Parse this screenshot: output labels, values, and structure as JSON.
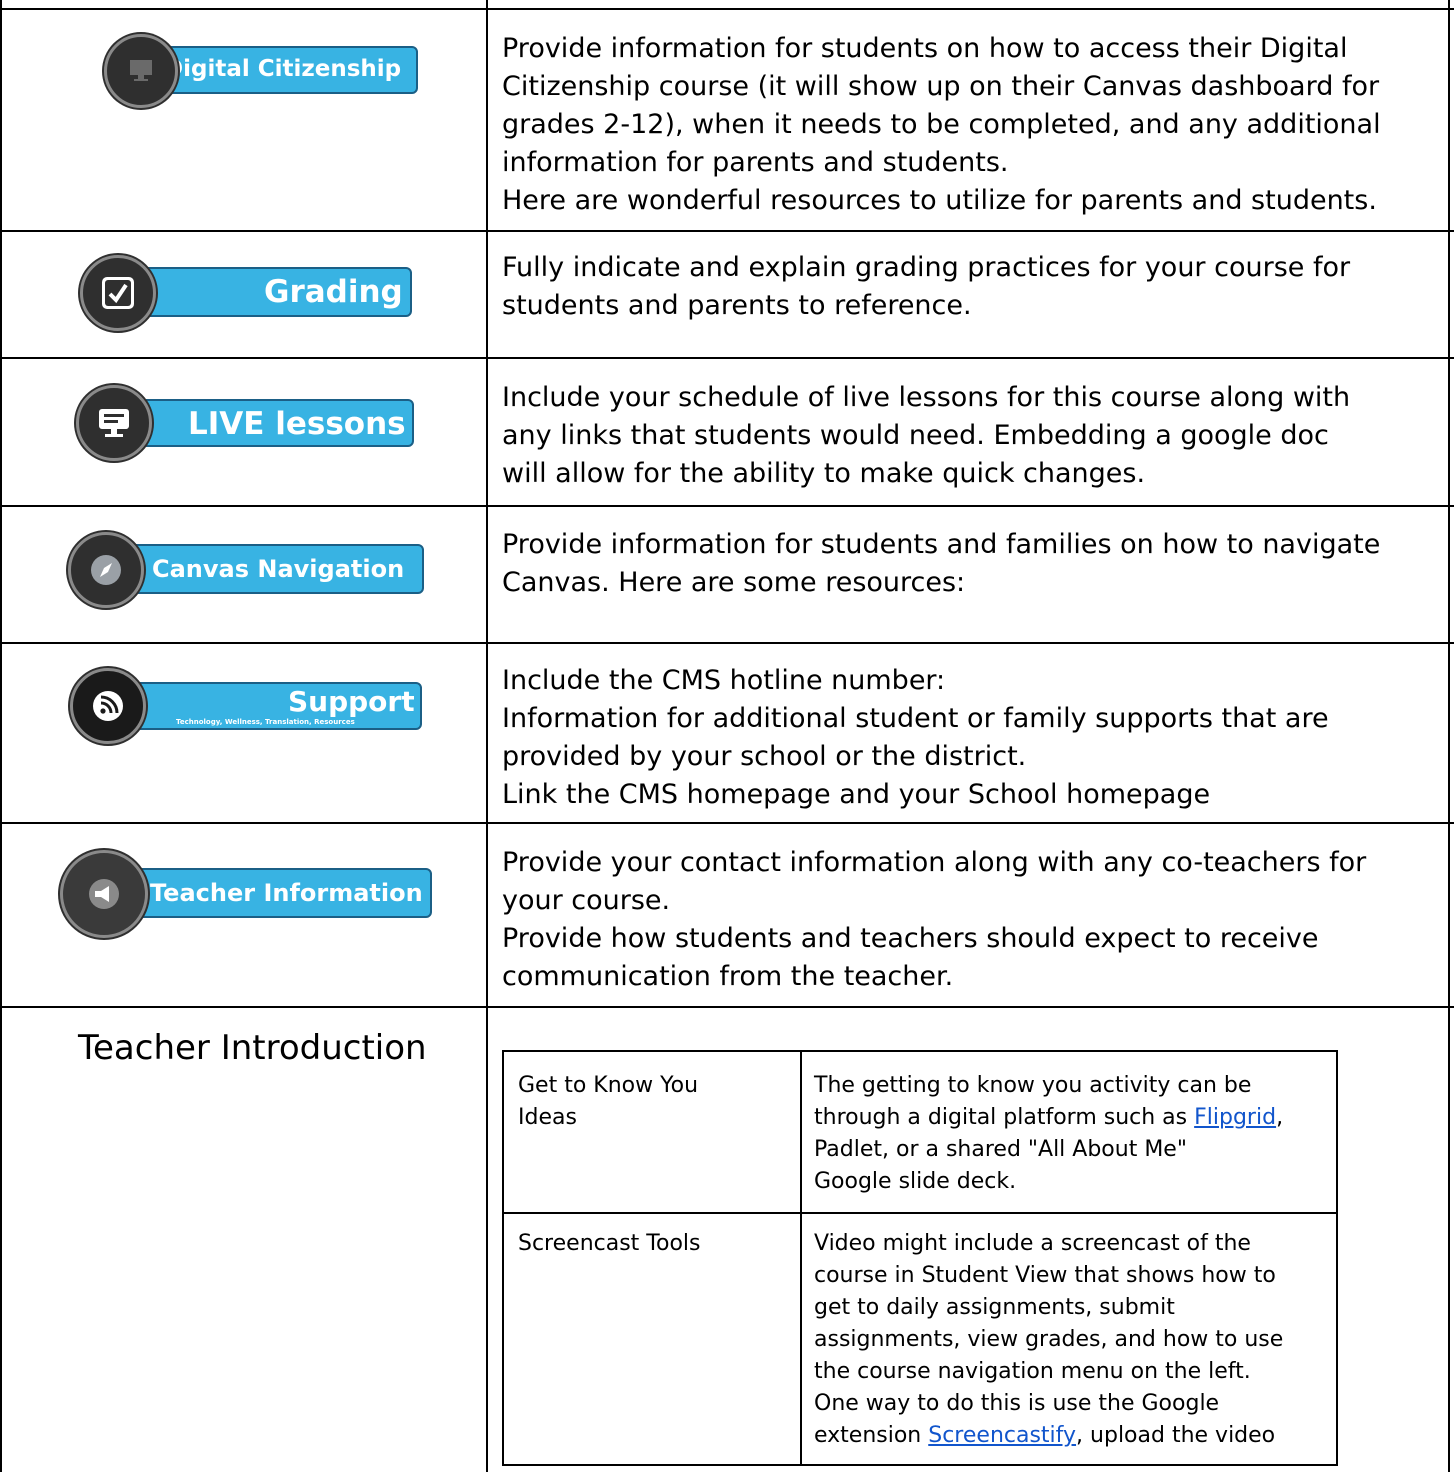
{
  "rows": [
    {
      "banner_label": "Digital Citizenship",
      "banner_icon": "computer-icon",
      "description_lines": [
        "Provide information for students on how to access their Digital",
        "Citizenship course (it will show up on their Canvas dashboard for",
        "grades 2-12), when it needs to be completed, and any additional",
        "information for parents and students.",
        "Here are wonderful resources to utilize for parents and students."
      ]
    },
    {
      "banner_label": "Grading",
      "banner_icon": "checkbox-icon",
      "description_lines": [
        "Fully indicate and explain grading practices for your course for",
        "students and parents to reference."
      ]
    },
    {
      "banner_label": "LIVE lessons",
      "banner_icon": "presentation-icon",
      "description_lines": [
        "Include your schedule of live lessons for this course along with",
        "any links that students would need.  Embedding a google doc",
        "will allow for the ability to make quick changes."
      ]
    },
    {
      "banner_label": "Canvas Navigation",
      "banner_icon": "compass-icon",
      "description_lines": [
        "Provide information for students and families on how to navigate",
        "Canvas. Here are some resources:"
      ]
    },
    {
      "banner_label": "Support",
      "banner_sublabel": "Technology, Wellness, Translation, Resources",
      "banner_icon": "rss-icon",
      "description_lines": [
        "Include the CMS hotline number:",
        "Information for additional student or family supports that are",
        "provided by your school or the district.",
        "Link the CMS homepage and your School homepage"
      ]
    },
    {
      "banner_label": "Teacher Information",
      "banner_icon": "megaphone-icon",
      "description_lines": [
        "Provide your contact information along with any co-teachers for",
        "your course.",
        "Provide how students and teachers should expect to receive",
        "communication from the teacher."
      ]
    }
  ],
  "teacher_intro": {
    "label": "Teacher Introduction",
    "inner_table": [
      {
        "label_lines": [
          "Get to Know You",
          "Ideas"
        ],
        "line1": "The getting to know you activity can be",
        "line2_before": "through a digital platform such as ",
        "line2_link": "Flipgrid",
        "line2_after": ",",
        "line3": "Padlet, or a shared \"All About Me\"",
        "line4": "Google slide deck."
      },
      {
        "label_lines": [
          "Screencast Tools"
        ],
        "lines": [
          "Video might include a screencast of the",
          "course in Student View that shows how to",
          "get to daily assignments, submit",
          "assignments, view grades, and how to use",
          "the course navigation menu on the left.",
          "One way to do this is use the Google"
        ],
        "last_before": "extension ",
        "last_link": "Screencastify",
        "last_after": ", upload the video"
      }
    ]
  },
  "colors": {
    "banner_fill": "#38b3e3",
    "banner_border": "#1b5f86",
    "icon_circle": "#2f2f2f",
    "link": "#1155cc"
  }
}
